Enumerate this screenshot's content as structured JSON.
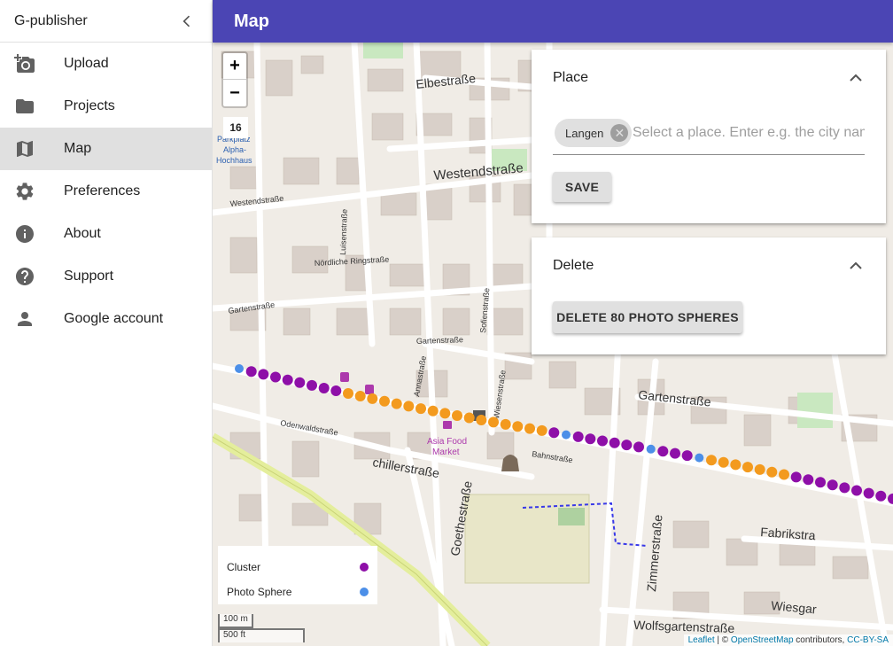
{
  "sidebar": {
    "app_title": "G-publisher",
    "items": [
      {
        "label": "Upload",
        "icon": "camera-add-icon",
        "active": false
      },
      {
        "label": "Projects",
        "icon": "folder-icon",
        "active": false
      },
      {
        "label": "Map",
        "icon": "map-icon",
        "active": true
      },
      {
        "label": "Preferences",
        "icon": "gear-icon",
        "active": false
      },
      {
        "label": "About",
        "icon": "info-icon",
        "active": false
      },
      {
        "label": "Support",
        "icon": "help-icon",
        "active": false
      },
      {
        "label": "Google account",
        "icon": "person-icon",
        "active": false
      }
    ]
  },
  "header": {
    "title": "Map"
  },
  "map": {
    "zoom_in": "+",
    "zoom_out": "−",
    "zoom_level": "16",
    "legend": [
      {
        "label": "Cluster",
        "color": "#8e0fa8"
      },
      {
        "label": "Photo Sphere",
        "color": "#4c8fe8"
      }
    ],
    "scale_m": "100 m",
    "scale_ft": "500 ft",
    "attribution": {
      "leaflet": "Leaflet",
      "sep1": " | © ",
      "osm": "OpenStreetMap",
      "contributors": " contributors, ",
      "license": "CC-BY-SA"
    },
    "street_labels": {
      "elbestrasse": "Elbestraße",
      "westendstrasse": "Westendstraße",
      "westendstrasse_small": "Westendstraße",
      "noerdliche_ringstrasse": "Nördliche Ringstraße",
      "gartenstrasse": "Gartenstraße",
      "gartenstrasse_right": "Gartenstraße",
      "gartenstrasse_left": "Gartenstraße",
      "odenwaldstrasse": "Odenwaldstraße",
      "bahnstrasse": "Bahnstraße",
      "fabrikstra": "Fabrikstra",
      "wolfsgartenstrasse": "Wolfsgartenstraße",
      "wiesgarten": "Wiesgar",
      "schillerstrasse": "chillerstraße",
      "goethestrasse": "Goethestraße",
      "zimmerstrasse": "Zimmerstraße",
      "sofienstrasse": "Sofienstraße",
      "annastrasse": "Annastraße",
      "luisenstrasse": "Luisenstraße",
      "wiesenstrasse": "Wiesenstraße",
      "asia_food": "Asia Food",
      "market": "Market",
      "parkplatz": "Parkplatz",
      "alpha": "Alpha-",
      "hochhaus": "Hochhaus"
    }
  },
  "place_panel": {
    "title": "Place",
    "chip_label": "Langen",
    "input_placeholder": "Select a place. Enter e.g. the city name",
    "save_label": "SAVE"
  },
  "delete_panel": {
    "title": "Delete",
    "delete_label": "DELETE 80 PHOTO SPHERES"
  },
  "colors": {
    "appbar": "#4b45b4",
    "cluster": "#8e0fa8",
    "photo_sphere": "#4c8fe8",
    "cluster_orange": "#f39a1e"
  }
}
